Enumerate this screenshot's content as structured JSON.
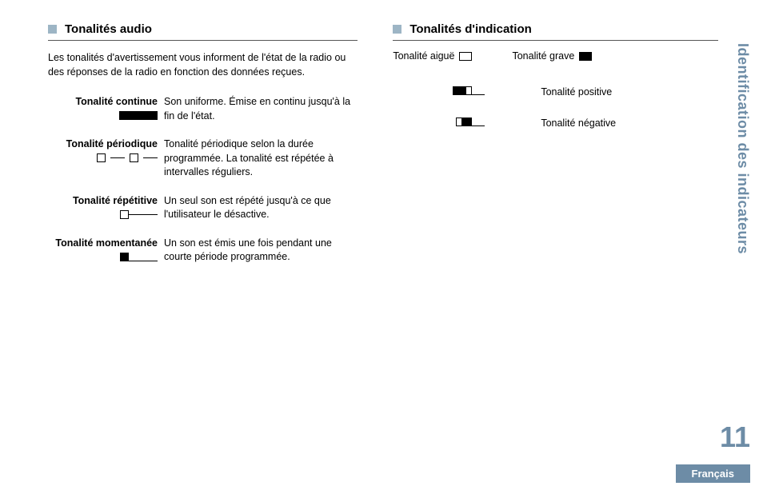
{
  "left": {
    "title": "Tonalités audio",
    "intro": "Les tonalités d'avertissement vous informent de l'état de la radio ou des réponses de la radio en fonction des données reçues.",
    "items": [
      {
        "label": "Tonalité continue",
        "desc": "Son uniforme. Émise en continu jusqu'à la fin de l'état."
      },
      {
        "label": "Tonalité périodique",
        "desc": "Tonalité périodique selon la durée programmée. La tonalité est répétée à intervalles réguliers."
      },
      {
        "label": "Tonalité répétitive",
        "desc": "Un seul son est répété jusqu'à ce que l'utilisateur le désactive."
      },
      {
        "label": "Tonalité momentanée",
        "desc": "Un son est émis une fois pendant une courte période programmée."
      }
    ]
  },
  "right": {
    "title": "Tonalités d'indication",
    "legend": {
      "high": "Tonalité aiguë",
      "low": "Tonalité grave"
    },
    "items": [
      {
        "label": "Tonalité positive"
      },
      {
        "label": "Tonalité négative"
      }
    ]
  },
  "side_title": "Identification des indicateurs",
  "page_number": "11",
  "language": "Français"
}
